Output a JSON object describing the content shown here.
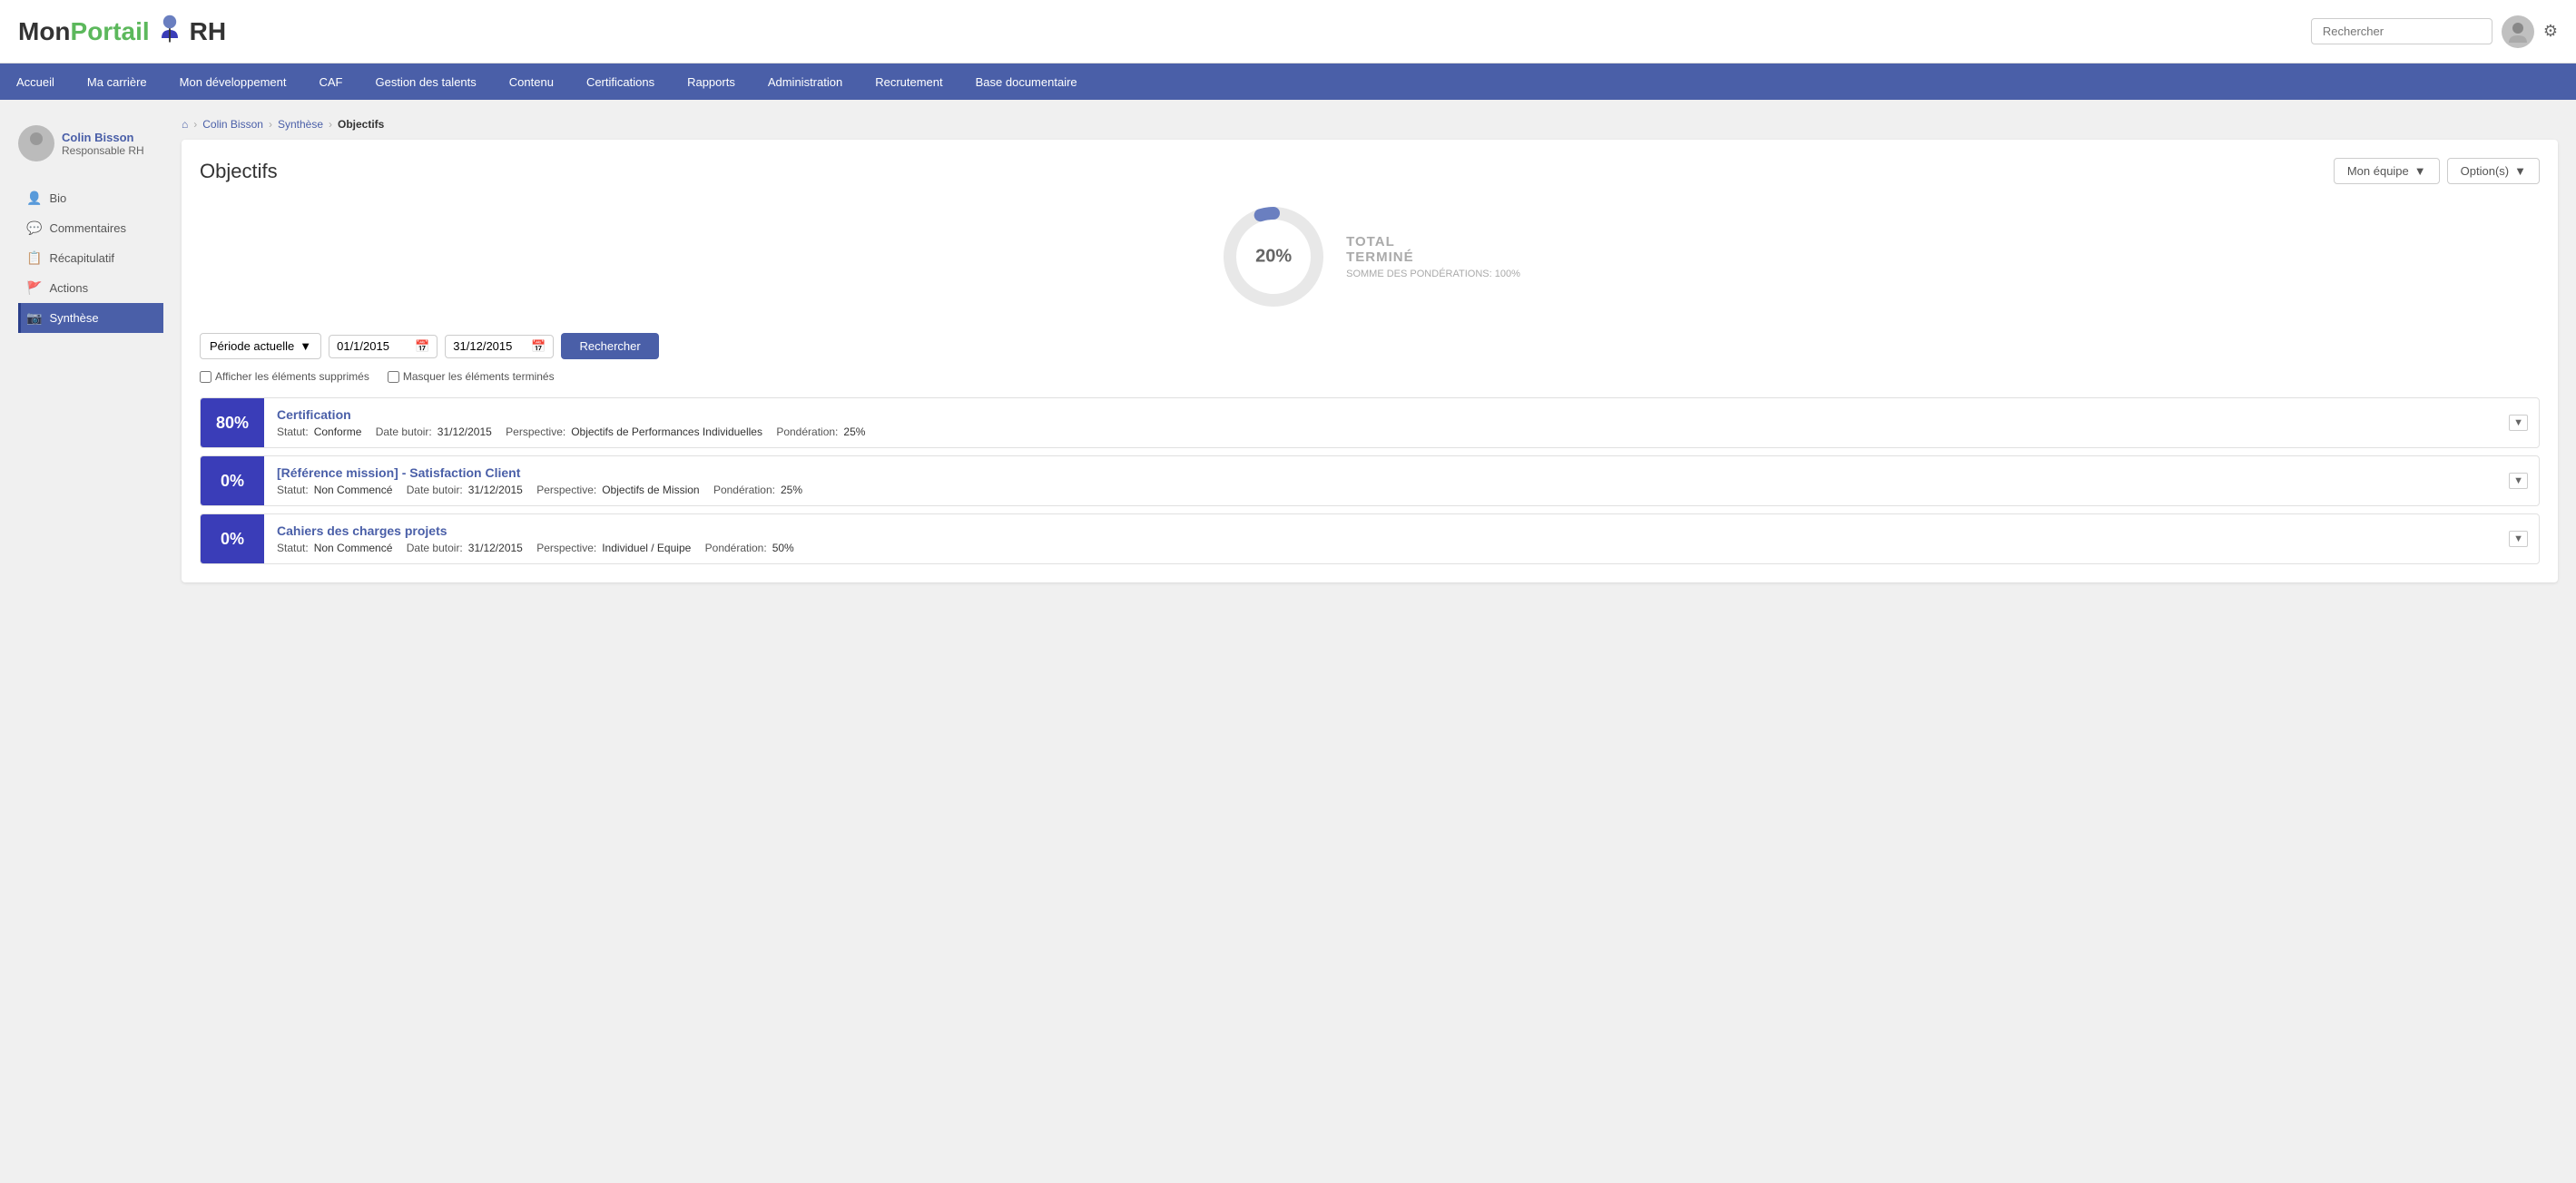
{
  "logo": {
    "mon": "Mon",
    "portail": "Portail",
    "rh": "RH"
  },
  "header": {
    "search_placeholder": "Rechercher"
  },
  "nav": {
    "items": [
      {
        "id": "accueil",
        "label": "Accueil"
      },
      {
        "id": "ma-carriere",
        "label": "Ma carrière"
      },
      {
        "id": "mon-developpement",
        "label": "Mon développement"
      },
      {
        "id": "caf",
        "label": "CAF"
      },
      {
        "id": "gestion-des-talents",
        "label": "Gestion des talents"
      },
      {
        "id": "contenu",
        "label": "Contenu"
      },
      {
        "id": "certifications",
        "label": "Certifications"
      },
      {
        "id": "rapports",
        "label": "Rapports"
      },
      {
        "id": "administration",
        "label": "Administration"
      },
      {
        "id": "recrutement",
        "label": "Recrutement"
      },
      {
        "id": "base-documentaire",
        "label": "Base documentaire"
      }
    ]
  },
  "breadcrumb": {
    "home_icon": "⌂",
    "user": "Colin Bisson",
    "section": "Synthèse",
    "current": "Objectifs"
  },
  "sidebar": {
    "user": {
      "name": "Colin Bisson",
      "role": "Responsable RH"
    },
    "items": [
      {
        "id": "bio",
        "label": "Bio",
        "icon": "👤"
      },
      {
        "id": "commentaires",
        "label": "Commentaires",
        "icon": "💬"
      },
      {
        "id": "recapitulatif",
        "label": "Récapitulatif",
        "icon": "📋"
      },
      {
        "id": "actions",
        "label": "Actions",
        "icon": "🚩"
      },
      {
        "id": "synthese",
        "label": "Synthèse",
        "icon": "📷",
        "active": true
      }
    ]
  },
  "page": {
    "title": "Objectifs",
    "btn_mon_equipe": "Mon équipe",
    "btn_options": "Option(s)"
  },
  "chart": {
    "percent": "20%",
    "total_label": "TOTAL",
    "termine_label": "TERMINÉ",
    "somme_label": "SOMME DES PONDÉRATIONS: 100%",
    "value": 20,
    "color_filled": "#6a7fc0",
    "color_empty": "#e8e8e8"
  },
  "filters": {
    "period_label": "Période actuelle",
    "date_from": "01/1/2015",
    "date_to": "31/12/2015",
    "btn_search": "Rechercher",
    "check_supprimes": "Afficher les éléments supprimés",
    "check_termines": "Masquer les éléments terminés"
  },
  "objectives": [
    {
      "pct": "80%",
      "title": "Certification",
      "statut_label": "Statut:",
      "statut_value": "Conforme",
      "date_label": "Date butoir:",
      "date_value": "31/12/2015",
      "perspective_label": "Perspective:",
      "perspective_value": "Objectifs de Performances Individuelles",
      "ponderation_label": "Pondération:",
      "ponderation_value": "25%"
    },
    {
      "pct": "0%",
      "title": "[Référence mission] - Satisfaction Client",
      "statut_label": "Statut:",
      "statut_value": "Non Commencé",
      "date_label": "Date butoir:",
      "date_value": "31/12/2015",
      "perspective_label": "Perspective:",
      "perspective_value": "Objectifs de Mission",
      "ponderation_label": "Pondération:",
      "ponderation_value": "25%"
    },
    {
      "pct": "0%",
      "title": "Cahiers des charges projets",
      "statut_label": "Statut:",
      "statut_value": "Non Commencé",
      "date_label": "Date butoir:",
      "date_value": "31/12/2015",
      "perspective_label": "Perspective:",
      "perspective_value": "Individuel / Equipe",
      "ponderation_label": "Pondération:",
      "ponderation_value": "50%"
    }
  ],
  "icons": {
    "home": "⌂",
    "chevron_down": "▼",
    "calendar": "📅",
    "gear": "⚙"
  }
}
